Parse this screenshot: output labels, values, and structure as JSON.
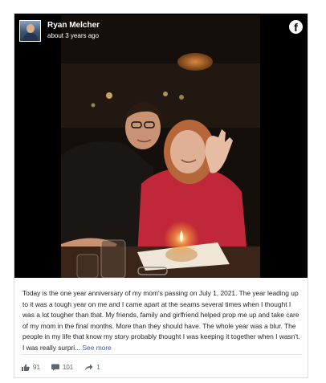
{
  "post": {
    "author": "Ryan Melcher",
    "timestamp": "about 3 years ago",
    "platform_icon": "facebook-icon",
    "text": "Today is the one year anniversary of my mom's passing on July 1, 2021. The year leading up to it was a tough year on me and I came apart at the seams several times when I thought I was a lot tougher than that. My friends, family and girlfriend helped prop me up and take care of my mom in the final months. More than they should have. The whole year was a blur. The people in my life that know my story probably thought I was keeping it together when I wasn't. I was really surpri... ",
    "see_more_label": "See more"
  },
  "stats": {
    "likes": "91",
    "comments": "101",
    "shares": "1"
  },
  "colors": {
    "link": "#385898",
    "muted": "#606770",
    "media_background": "#000000"
  }
}
